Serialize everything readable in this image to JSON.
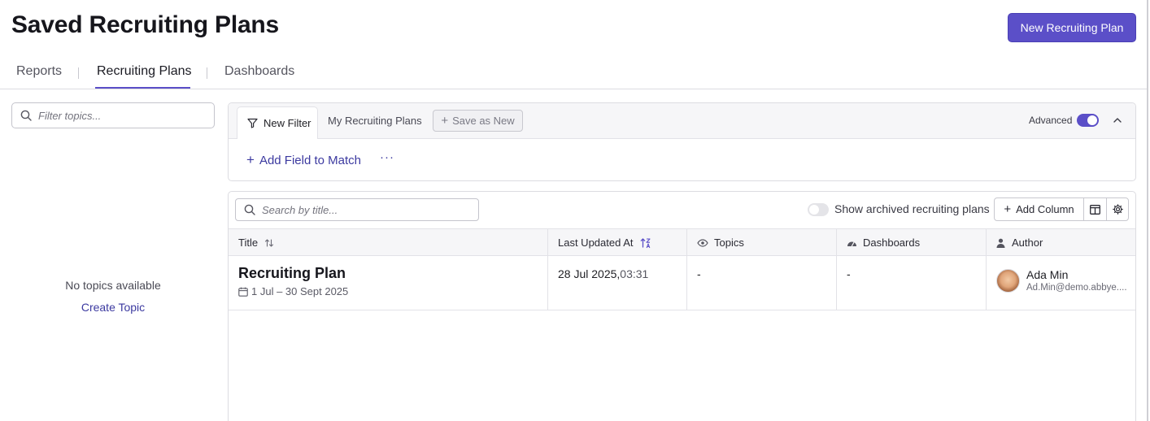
{
  "header": {
    "title": "Saved Recruiting Plans",
    "new_plan_label": "New Recruiting Plan"
  },
  "tabs": [
    {
      "label": "Reports",
      "active": false
    },
    {
      "label": "Recruiting Plans",
      "active": true
    },
    {
      "label": "Dashboards",
      "active": false
    }
  ],
  "sidebar": {
    "filter_placeholder": "Filter topics...",
    "empty_text": "No topics available",
    "create_label": "Create Topic"
  },
  "filter_panel": {
    "new_filter_label": "New Filter",
    "my_plans_label": "My Recruiting Plans",
    "save_as_new_label": "Save as New",
    "advanced_label": "Advanced",
    "advanced_enabled": true,
    "add_field_label": "Add Field to Match",
    "more_label": "···"
  },
  "table_toolbar": {
    "search_placeholder": "Search by title...",
    "show_archived_label": "Show archived recruiting plans",
    "show_archived_enabled": false,
    "add_column_label": "Add Column"
  },
  "table": {
    "columns": [
      "Title",
      "Last Updated At",
      "Topics",
      "Dashboards",
      "Author"
    ],
    "rows": [
      {
        "title": "Recruiting Plan",
        "date_range": "1 Jul – 30 Sept 2025",
        "updated_date": "28 Jul 2025,",
        "updated_time": "03:31",
        "topics": "-",
        "dashboards": "-",
        "author_name": "Ada Min",
        "author_email": "Ad.Min@demo.abbye...."
      }
    ]
  },
  "colors": {
    "accent": "#5b4fc8",
    "link": "#3c3aa0",
    "border": "#dcdce1",
    "header_bg": "#f6f6f8"
  },
  "icons": {
    "search": "search-icon",
    "filter": "filter-icon",
    "chevron_up": "chevron-up-icon",
    "sort": "sort-icon",
    "sort_asc": "sort-ascending-icon",
    "eye": "eye-icon",
    "dashboard": "dashboard-gauge-icon",
    "person": "person-icon",
    "calendar": "calendar-icon",
    "columns": "columns-icon",
    "gear": "gear-icon"
  }
}
